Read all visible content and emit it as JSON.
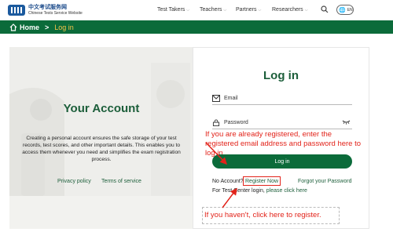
{
  "header": {
    "logo_cn": "中文考试服务网",
    "logo_en": "Chinese Tests Service Website",
    "nav": [
      "Test Takers",
      "Teachers",
      "Partners",
      "Researchers"
    ],
    "lang": "EN"
  },
  "breadcrumb": {
    "home": "Home",
    "separator": ">",
    "current": "Log in"
  },
  "left": {
    "title": "Your Account",
    "description": "Creating a personal account ensures the safe storage of your test records, test scores, and other important details. This enables you to access them whenever you need and simplifies the exam registration process.",
    "privacy": "Privacy policy",
    "terms": "Terms of service"
  },
  "login": {
    "title": "Log in",
    "email_label": "Email",
    "password_label": "Password",
    "button": "Log in",
    "no_account": "No Account?",
    "register": "Register Now",
    "forgot": "Forgot your Password",
    "test_center_prefix": "For Test Center login,",
    "test_center_link": "please click here"
  },
  "annotations": {
    "top": "If you  are already  registered, enter the registered email address and password here to log in.",
    "bottom": "If you haven't,  click here to register."
  },
  "colors": {
    "brand_green": "#0b6b3a",
    "accent_red": "#e2231a",
    "crumb_current": "#f5c44a"
  }
}
